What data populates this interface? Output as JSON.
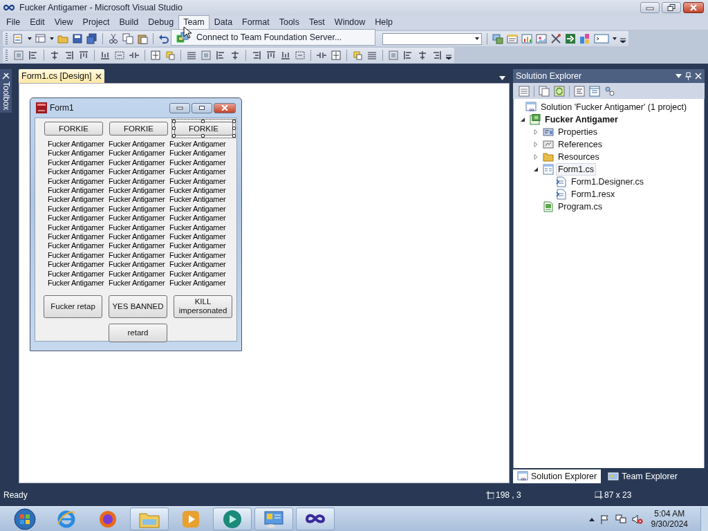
{
  "window": {
    "title": "Fucker Antigamer - Microsoft Visual Studio"
  },
  "menu": [
    {
      "label": "File",
      "selected": false
    },
    {
      "label": "Edit",
      "selected": false
    },
    {
      "label": "View",
      "selected": false
    },
    {
      "label": "Project",
      "selected": false
    },
    {
      "label": "Build",
      "selected": false
    },
    {
      "label": "Debug",
      "selected": false
    },
    {
      "label": "Team",
      "selected": true
    },
    {
      "label": "Data",
      "selected": false
    },
    {
      "label": "Format",
      "selected": false
    },
    {
      "label": "Tools",
      "selected": false
    },
    {
      "label": "Test",
      "selected": false
    },
    {
      "label": "Window",
      "selected": false
    },
    {
      "label": "Help",
      "selected": false
    }
  ],
  "team_menu": {
    "items": [
      "Connect to Team Foundation Server..."
    ]
  },
  "toolbox": {
    "label": "Toolbox"
  },
  "document_tabs": [
    {
      "label": "Form1.cs [Design]",
      "selected": true
    }
  ],
  "form": {
    "title": "Form1",
    "top_buttons": [
      {
        "label": "FORKIE",
        "selected": false
      },
      {
        "label": "FORKIE",
        "selected": false
      },
      {
        "label": "FORKIE",
        "selected": true
      }
    ],
    "labels": [
      [
        "Fucker Antigamer",
        "Fucker Antigamer",
        "Fucker Antigamer"
      ],
      [
        "Fucker Antigamer",
        "Fucker Antigamer",
        "Fucker Antigamer"
      ],
      [
        "Fucker Antigamer",
        "Fucker Antigamer",
        "Fucker Antigamer"
      ],
      [
        "Fucker Antigamer",
        "Fucker Antigamer",
        "Fucker Antigamer"
      ],
      [
        "Fucker Antigamer",
        "Fucker Antigamer",
        "Fucker Antigamer"
      ],
      [
        "Fucker Antigamer",
        "Fucker Antigamer",
        "Fucker Antigamer"
      ],
      [
        "Fucker Antigamer",
        "Fucker Antigamer",
        "Fucker Antigamer"
      ],
      [
        "Fucker Antigamer",
        "Fucker Antigamer",
        "Fucker Antigamer"
      ],
      [
        "Fucker Antigamer",
        "Fucker Antigamer",
        "Fucker Antigamer"
      ],
      [
        "Fucker Antigamer",
        "Fucker Antigamer",
        "Fucker Antigamer"
      ],
      [
        "Fucker Antigamer",
        "Fucker Antigamer",
        "Fucker Antigamer"
      ],
      [
        "Fucker Antigamer",
        "Fucker Antigamer",
        "Fucker Antigamer"
      ],
      [
        "Fucker Antigamer",
        "Fucker Antigamer",
        "Fucker Antigamer"
      ],
      [
        "Fucker Antigamer",
        "Fucker Antigamer",
        "Fucker Antigamer"
      ],
      [
        "Fucker Antigamer",
        "Fucker Antigamer",
        "Fucker Antigamer"
      ],
      [
        "Fucker Antigamer",
        "Fucker Antigamer",
        "Fucker Antigamer"
      ]
    ],
    "bottom_buttons": [
      "Fucker retap",
      "YES BANNED",
      "KILL impersonated",
      "retard"
    ]
  },
  "solution_explorer": {
    "title": "Solution Explorer",
    "tree": [
      {
        "label": "Solution 'Fucker Antigamer' (1 project)",
        "kind": "solution",
        "selected": false,
        "children": [
          {
            "label": "Fucker Antigamer",
            "kind": "project",
            "selected": false,
            "expanded": true,
            "children": [
              {
                "label": "Properties",
                "kind": "properties",
                "selected": false,
                "expanded": false
              },
              {
                "label": "References",
                "kind": "references",
                "selected": false,
                "expanded": false
              },
              {
                "label": "Resources",
                "kind": "folder",
                "selected": false,
                "expanded": false
              },
              {
                "label": "Form1.cs",
                "kind": "form",
                "selected": true,
                "expanded": true,
                "children": [
                  {
                    "label": "Form1.Designer.cs",
                    "kind": "file",
                    "selected": false
                  },
                  {
                    "label": "Form1.resx",
                    "kind": "file",
                    "selected": false
                  }
                ]
              },
              {
                "label": "Program.cs",
                "kind": "code",
                "selected": false
              }
            ]
          }
        ]
      }
    ]
  },
  "bottom_tabs": [
    {
      "label": "Solution Explorer",
      "selected": true
    },
    {
      "label": "Team Explorer",
      "selected": false
    }
  ],
  "status_bar": {
    "text": "Ready",
    "position": "198 , 3",
    "size": "87 x 23"
  },
  "taskbar": {
    "time": "5:04 AM",
    "date": "9/30/2024"
  }
}
